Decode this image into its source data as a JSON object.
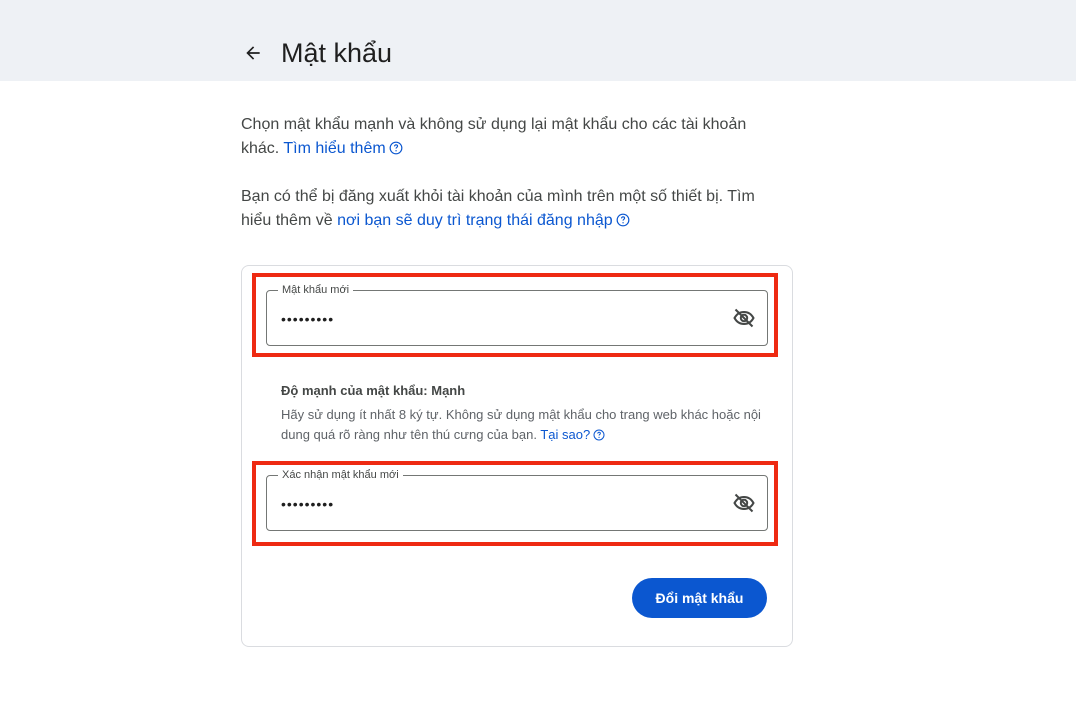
{
  "header": {
    "title": "Mật khẩu",
    "back_icon": "arrow-back-icon"
  },
  "intro": {
    "text1": "Chọn mật khẩu mạnh và không sử dụng lại mật khẩu cho các tài khoản khác. ",
    "link1": "Tìm hiểu thêm",
    "text2": "Bạn có thể bị đăng xuất khỏi tài khoản của mình trên một số thiết bị. Tìm hiểu thêm về ",
    "link2": "nơi bạn sẽ duy trì trạng thái đăng nhập",
    "help_icon": "help-circle-icon"
  },
  "form": {
    "new_password": {
      "label": "Mật khẩu mới",
      "value": "•••••••••",
      "toggle_icon": "eye-off-icon"
    },
    "strength_label": "Độ mạnh của mật khẩu: Mạnh",
    "hint_text": "Hãy sử dụng ít nhất 8 ký tự. Không sử dụng mật khẩu cho trang web khác hoặc nội dung quá rõ ràng như tên thú cưng của bạn. ",
    "hint_link": "Tại sao?",
    "confirm_password": {
      "label": "Xác nhận mật khẩu mới",
      "value": "•••••••••",
      "toggle_icon": "eye-off-icon"
    },
    "submit_label": "Đổi mật khẩu"
  },
  "colors": {
    "accent": "#0b57d0",
    "highlight": "#ee2a12",
    "header_bg": "#eef1f5"
  }
}
